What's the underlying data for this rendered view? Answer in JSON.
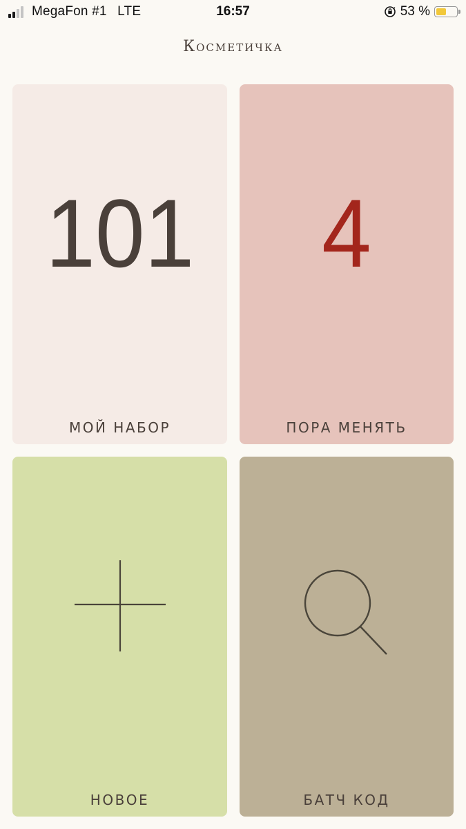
{
  "status_bar": {
    "carrier": "MegaFon #1",
    "network": "LTE",
    "time": "16:57",
    "battery_text": "53 %",
    "battery_level": 0.53,
    "signal_bars_active": 2,
    "signal_bars_total": 4
  },
  "header": {
    "title": "Косметичка"
  },
  "tiles": {
    "my_set": {
      "count": "101",
      "label": "МОЙ НАБОР",
      "background": "#f5ebe6",
      "text_color": "#4a403a"
    },
    "replace": {
      "count": "4",
      "label": "ПОРА МЕНЯТЬ",
      "background": "#e6c3bb",
      "text_color": "#4a403a",
      "count_color": "#a3261c"
    },
    "new": {
      "icon": "plus-icon",
      "label": "НОВОЕ",
      "background": "#d6dfa8",
      "text_color": "#4a403a"
    },
    "batch": {
      "icon": "search-icon",
      "label": "БАТЧ КОД",
      "background": "#bcb096",
      "text_color": "#4a403a"
    }
  }
}
